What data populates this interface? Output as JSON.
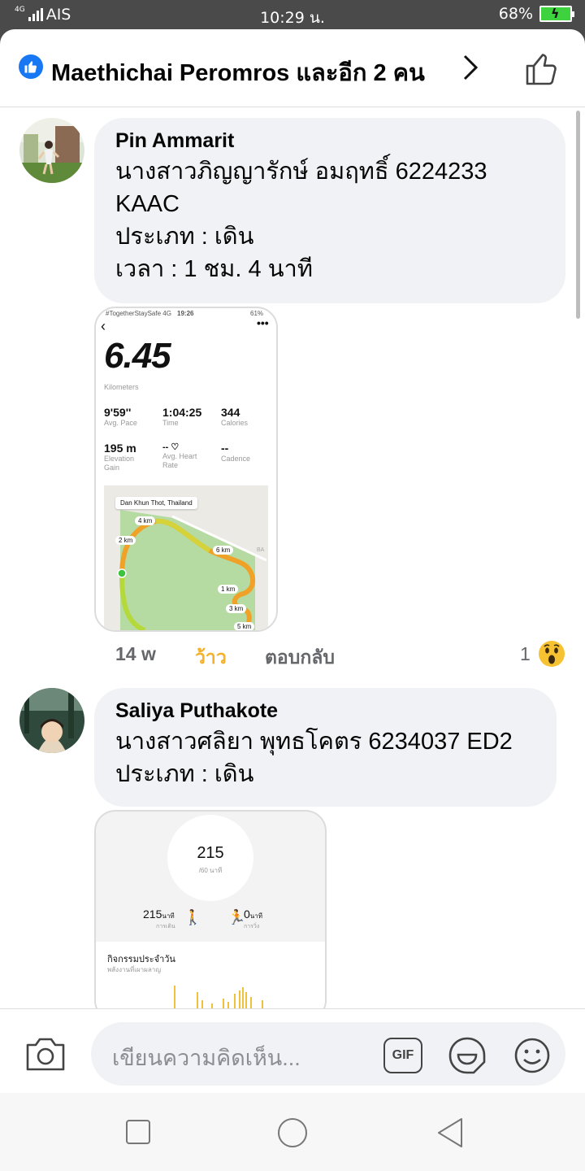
{
  "status_bar": {
    "network": "4G",
    "carrier": "AIS",
    "time": "10:29 น.",
    "battery": "68%"
  },
  "header": {
    "title": "Maethichai Peromros และอีก 2 คน"
  },
  "comments": [
    {
      "author": "Pin Ammarit",
      "lines": [
        "นางสาวภิญญารักษ์  อมฤทธิ์ 6224233",
        "KAAC",
        "ประเภท : เดิน",
        "เวลา  :  1 ชม.  4  นาที"
      ],
      "time": "14 w",
      "reaction_label": "ว้าว",
      "reply_label": "ตอบกลับ",
      "reaction_count": "1",
      "screenshot": {
        "status_left": "#TogetherStaySafe  4G",
        "status_time": "19:26",
        "status_right": "61%",
        "distance": "6.45",
        "distance_unit": "Kilometers",
        "stats": [
          {
            "value": "9'59''",
            "label": "Avg. Pace"
          },
          {
            "value": "1:04:25",
            "label": "Time"
          },
          {
            "value": "344",
            "label": "Calories"
          },
          {
            "value": "195 m",
            "label": "Elevation Gain"
          },
          {
            "value": "-- ♡",
            "label": "Avg. Heart Rate"
          },
          {
            "value": "--",
            "label": "Cadence"
          }
        ],
        "map_location": "Dan Khun Thot, Thailand",
        "km_markers": [
          "4 km",
          "2 km",
          "6 km",
          "1 km",
          "3 km",
          "5 km"
        ],
        "map_edge_text": "BA"
      }
    },
    {
      "author": "Saliya Puthakote",
      "lines": [
        "นางสาวศลิยา พุทธโคตร 6234037 ED2",
        "ประเภท : เดิน"
      ],
      "screenshot": {
        "total": "215",
        "total_sub": "/60 นาที",
        "walk_value": "215",
        "walk_unit": "นาที",
        "walk_label": "การเดิน",
        "run_value": "0",
        "run_unit": "นาที",
        "run_label": "การวิ่ง",
        "daily_title": "กิจกรรมประจำวัน",
        "daily_sub": "พลังงานที่เผาผลาญ"
      }
    }
  ],
  "composer": {
    "placeholder": "เขียนความคิดเห็น...",
    "gif_label": "GIF"
  },
  "colors": {
    "accent": "#1877f2",
    "wow": "#f5b12a",
    "bubble": "#f0f2f5"
  }
}
